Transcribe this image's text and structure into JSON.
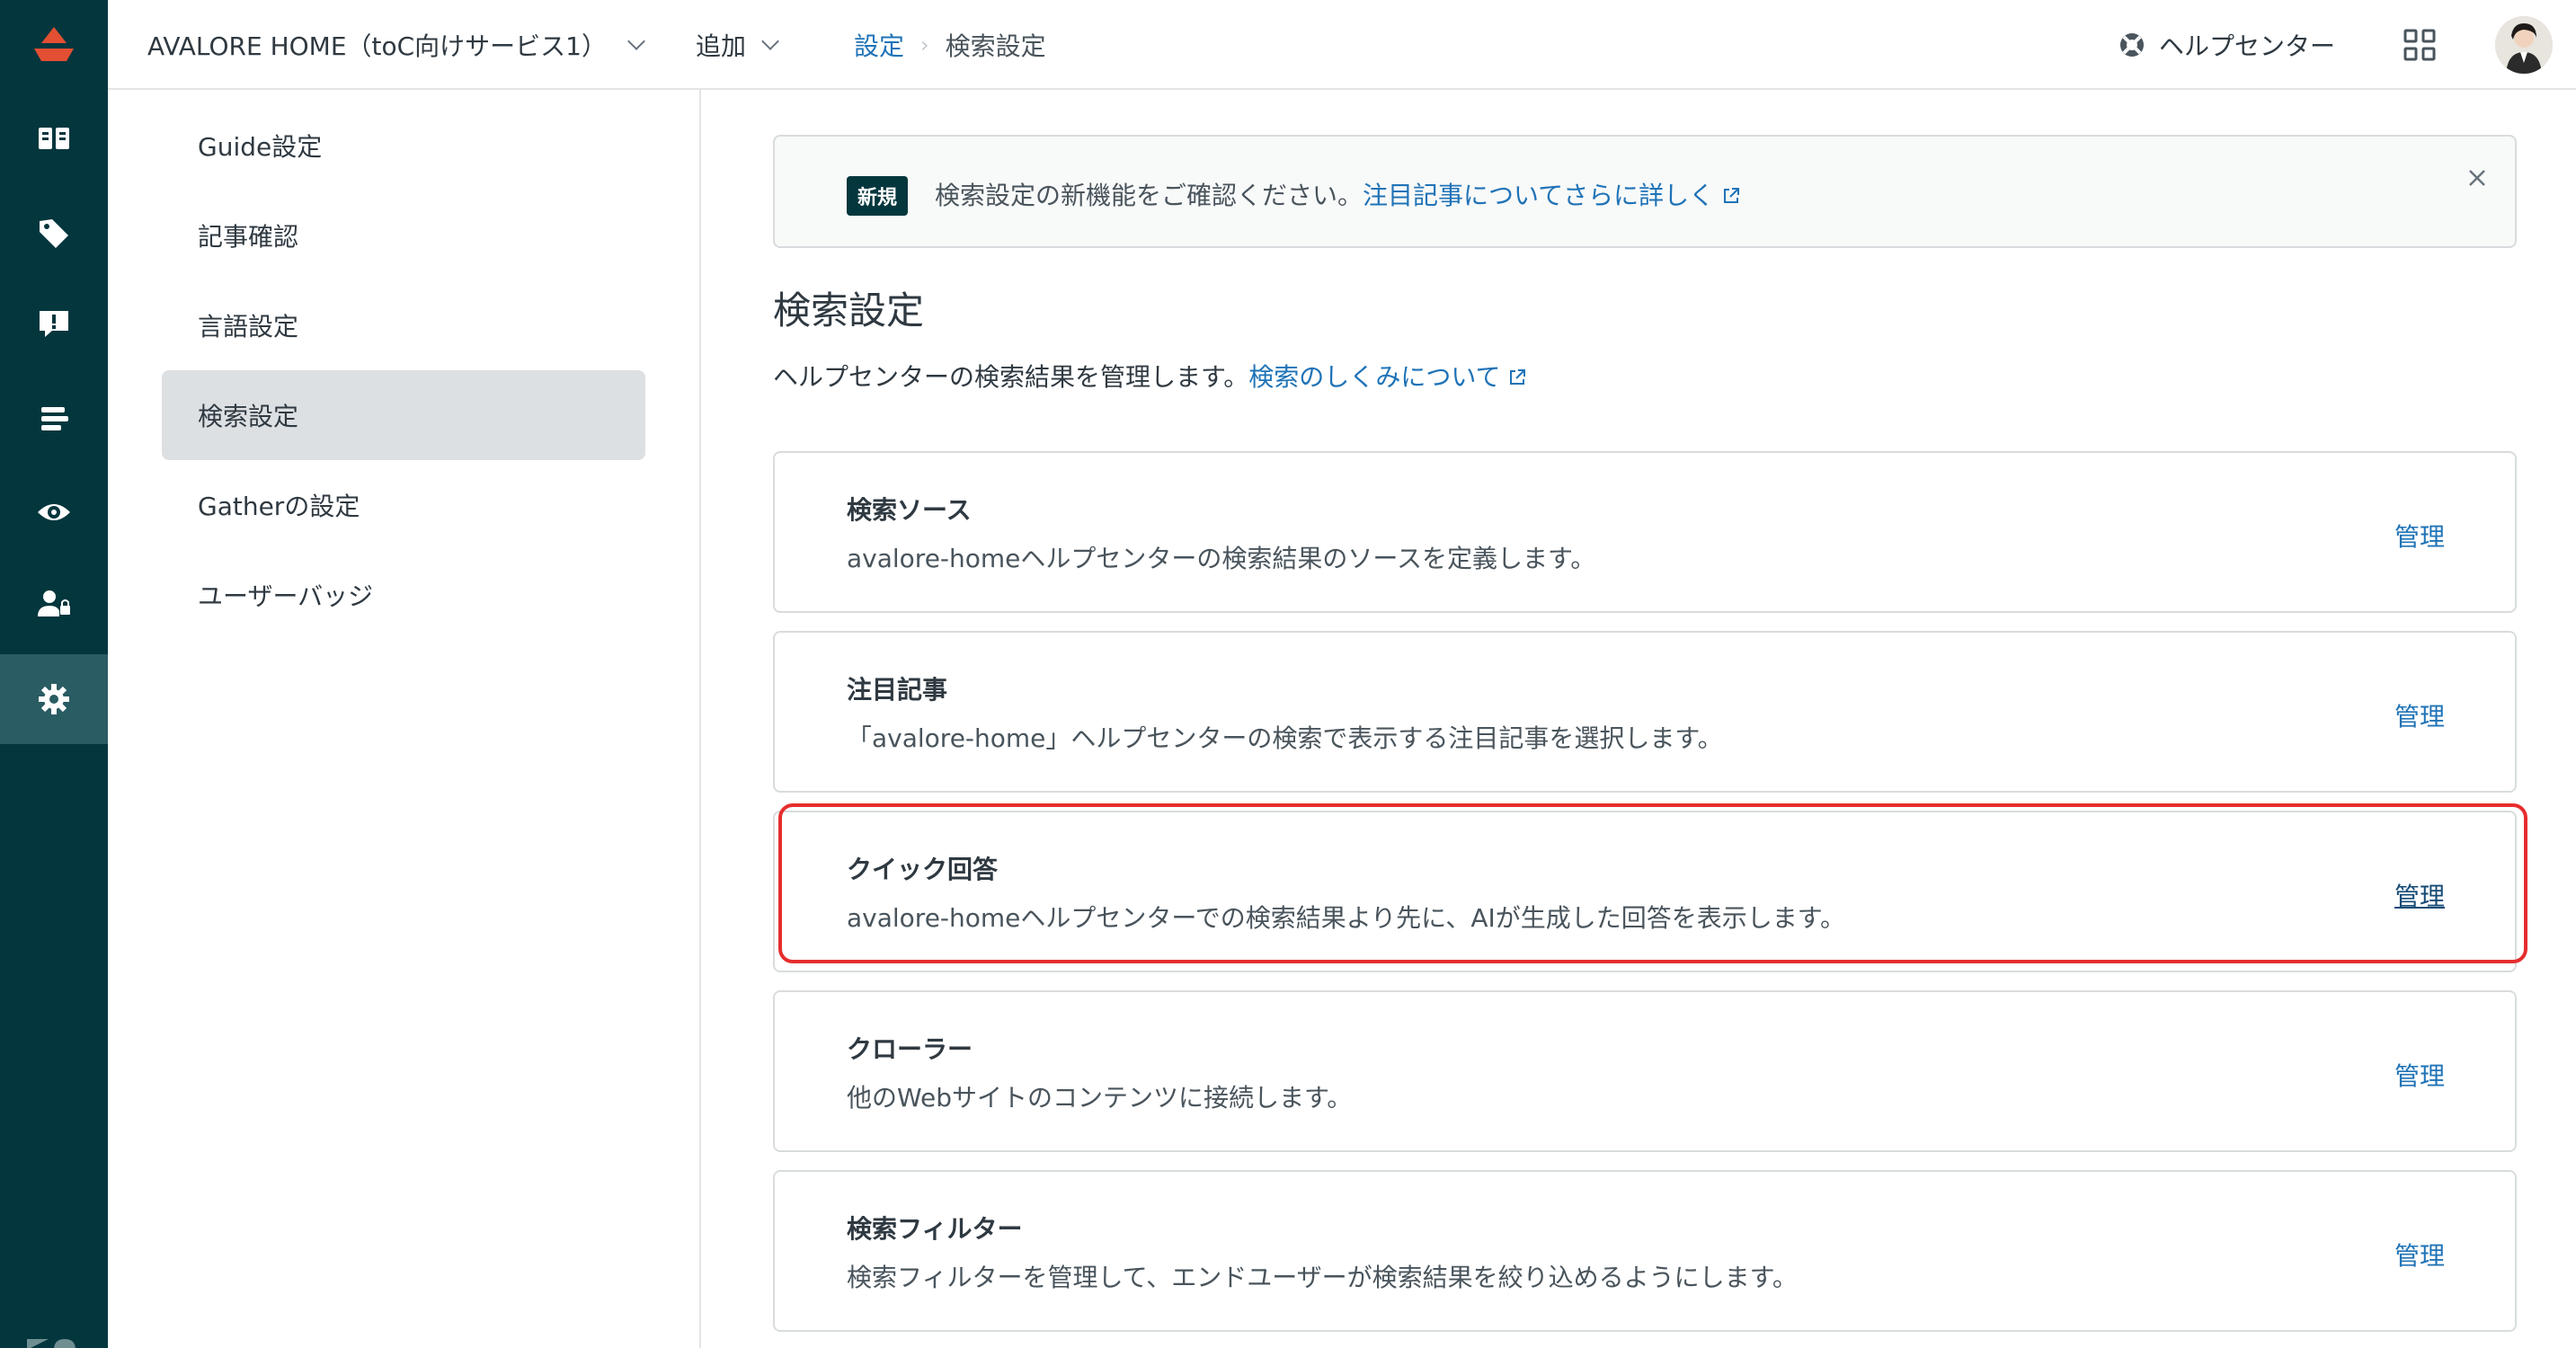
{
  "app": {
    "brand_label": "AVALORE HOME（toC向けサービス1）",
    "add_label": "追加",
    "help_center_label": "ヘルプセンター",
    "colors": {
      "rail_bg": "#03363d",
      "accent_link": "#1f73b7",
      "logo_red": "#e34f32",
      "highlight_red": "#e62d2d"
    }
  },
  "breadcrumb": {
    "parent": "設定",
    "separator": "›",
    "current": "検索設定"
  },
  "rail": {
    "icons": [
      "book-icon",
      "tag-icon",
      "alert-icon",
      "list-icon",
      "eye-icon",
      "user-lock-icon",
      "gear-icon"
    ],
    "active": "gear-icon"
  },
  "sidebar": {
    "items": [
      {
        "label": "Guide設定"
      },
      {
        "label": "記事確認"
      },
      {
        "label": "言語設定"
      },
      {
        "label": "検索設定",
        "active": true
      },
      {
        "label": "Gatherの設定"
      },
      {
        "label": "ユーザーバッジ"
      }
    ]
  },
  "notice": {
    "badge": "新規",
    "text": "検索設定の新機能をご確認ください。",
    "link": "注目記事についてさらに詳しく"
  },
  "page": {
    "title": "検索設定",
    "description": "ヘルプセンターの検索結果を管理します。",
    "description_link": "検索のしくみについて"
  },
  "cards": [
    {
      "title": "検索ソース",
      "description": "avalore-homeヘルプセンターの検索結果のソースを定義します。",
      "action": "管理"
    },
    {
      "title": "注目記事",
      "description": "「avalore-home」ヘルプセンターの検索で表示する注目記事を選択します。",
      "action": "管理"
    },
    {
      "title": "クイック回答",
      "description": "avalore-homeヘルプセンターでの検索結果より先に、AIが生成した回答を表示します。",
      "action": "管理",
      "highlighted": true
    },
    {
      "title": "クローラー",
      "description": "他のWebサイトのコンテンツに接続します。",
      "action": "管理"
    },
    {
      "title": "検索フィルター",
      "description": "検索フィルターを管理して、エンドユーザーが検索結果を絞り込めるようにします。",
      "action": "管理"
    }
  ]
}
